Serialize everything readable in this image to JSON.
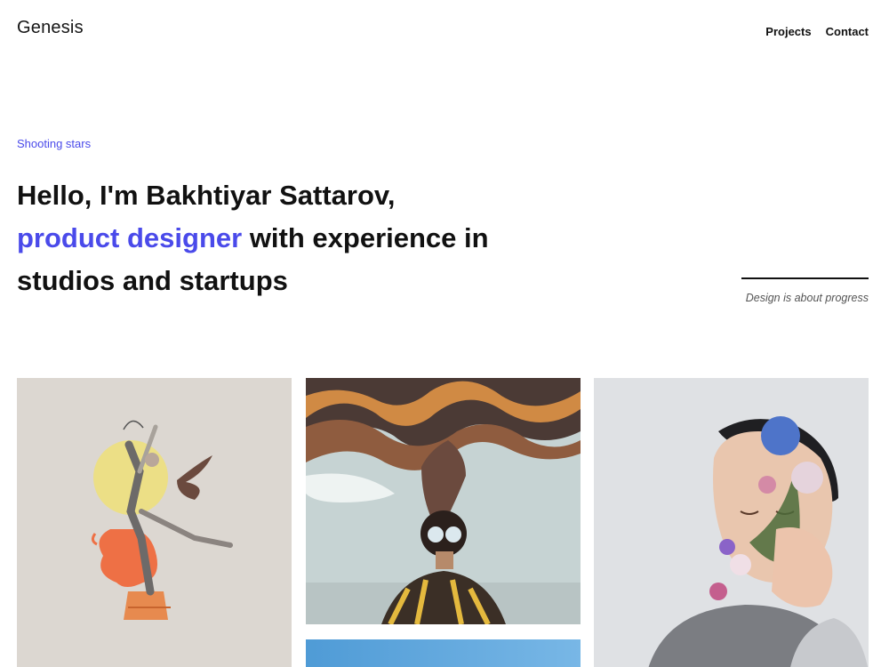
{
  "brand": {
    "name": "Genesis"
  },
  "nav": {
    "items": [
      "Projects",
      "Contact"
    ]
  },
  "hero": {
    "eyebrow": "Shooting stars",
    "line1": "Hello, I'm Bakhtiyar Sattarov,",
    "accent": "product designer",
    "line2_rest": " with experience in",
    "line3": "studios and startups"
  },
  "motto": "Design is about progress",
  "colors": {
    "accent": "#4a4aea",
    "text": "#111111",
    "muted": "#555555"
  },
  "gallery": {
    "tiles": [
      {
        "icon": "dancer-collage-image"
      },
      {
        "icon": "swirling-smoke-portrait-image"
      },
      {
        "icon": "flower-face-portrait-image"
      },
      {
        "icon": "sky-image"
      }
    ]
  }
}
